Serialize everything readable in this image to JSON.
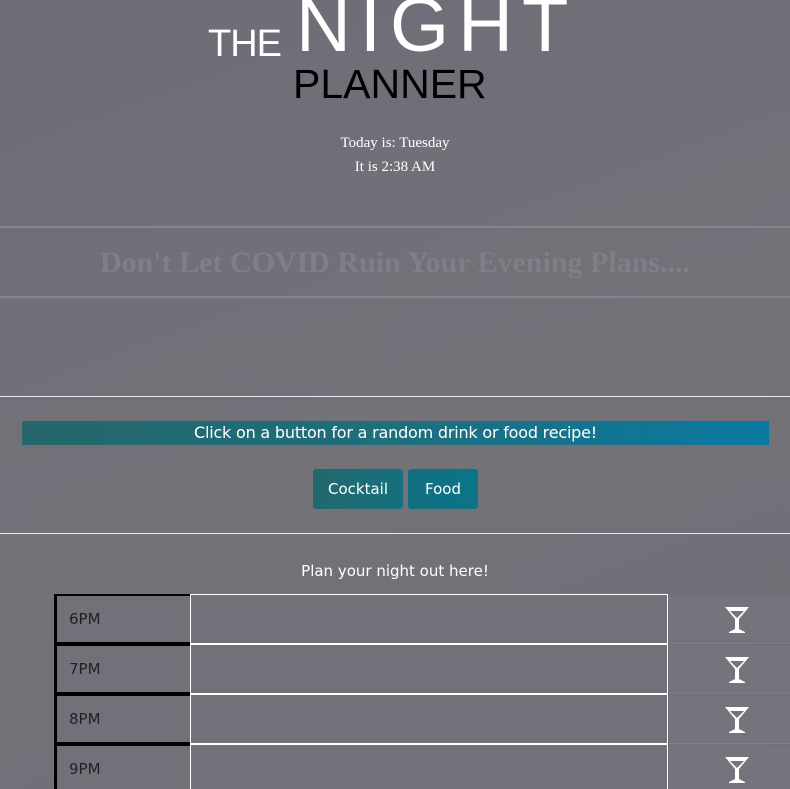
{
  "header": {
    "logo_the": "THE",
    "logo_night": "NIGHT",
    "logo_planner": "PLANNER",
    "today_line": "Today is: Tuesday",
    "time_line": "It is 2:38 AM"
  },
  "banner": {
    "text": "Don't Let COVID Ruin Your Evening Plans...."
  },
  "recipes": {
    "prompt": "Click on a button for a random drink or food recipe!",
    "cocktail_label": "Cocktail",
    "food_label": "Food"
  },
  "planner": {
    "intro": "Plan your night out here!",
    "rows": [
      {
        "hour": "6PM",
        "entry": "",
        "save_icon": "martini-glass-icon"
      },
      {
        "hour": "7PM",
        "entry": "",
        "save_icon": "martini-glass-icon"
      },
      {
        "hour": "8PM",
        "entry": "",
        "save_icon": "martini-glass-icon"
      },
      {
        "hour": "9PM",
        "entry": "",
        "save_icon": "martini-glass-icon"
      }
    ]
  },
  "colors": {
    "background": "#6f6e78",
    "accent_teal": "#23686d",
    "accent_blue": "#0a79a2",
    "banner_text": "#807f87"
  }
}
